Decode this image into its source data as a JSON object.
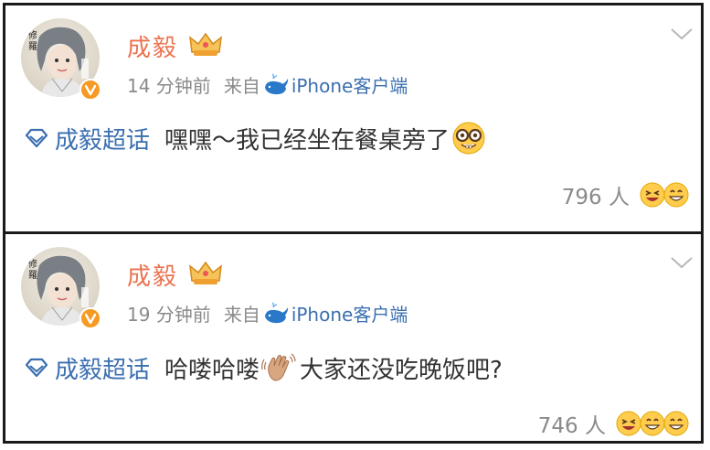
{
  "posts": [
    {
      "user_name": "成毅",
      "time": "14 分钟前",
      "source_prefix": "来自",
      "source": "iPhone客户端",
      "topic": "成毅超话",
      "text": "嘿嘿～我已经坐在餐桌旁了",
      "likes": "796 人",
      "emoji": "nerd-face-icon"
    },
    {
      "user_name": "成毅",
      "time": "19 分钟前",
      "source_prefix": "来自",
      "source": "iPhone客户端",
      "topic": "成毅超话",
      "text_before": "哈喽哈喽",
      "text_after": "大家还没吃晚饭吧?",
      "likes": "746 人",
      "emoji": "waving-hand-icon"
    }
  ],
  "colors": {
    "username": "#eb7350",
    "link": "#3b6fb0",
    "meta": "#8a8a8a",
    "text": "#333333"
  }
}
